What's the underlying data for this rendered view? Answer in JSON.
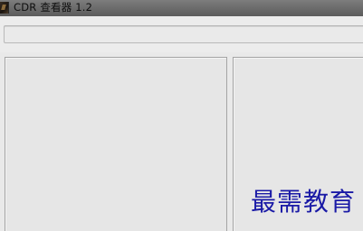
{
  "window": {
    "title": "CDR 查看器 1.2",
    "app_icon": "cdr-viewer-app-icon"
  },
  "toolbar": {
    "path_field": {
      "value": "",
      "placeholder": ""
    }
  },
  "panes": {
    "left": {
      "name": "file-tree-pane"
    },
    "right": {
      "name": "preview-pane"
    }
  },
  "watermark": {
    "text": "最需教育"
  },
  "colors": {
    "titlebar": "#6a6a6a",
    "window_bg": "#e9e9e9",
    "pane_border": "#a4a4a4",
    "watermark": "#1a1aa6"
  }
}
